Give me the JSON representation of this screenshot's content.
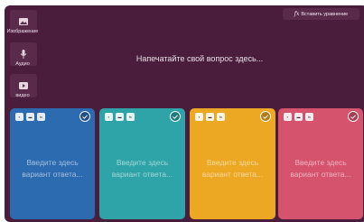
{
  "sidebar": {
    "image_label": "Изображение",
    "audio_label": "Аудио",
    "video_label": "видео"
  },
  "toolbar": {
    "insert_equation_label": "Вставить уравнение"
  },
  "question": {
    "placeholder": "Напечатайте свой вопрос здесь..."
  },
  "answers": [
    {
      "placeholder_line1": "Введите здесь",
      "placeholder_line2": "вариант ответа...",
      "color": "#2d6bb0"
    },
    {
      "placeholder_line1": "Введите здесь",
      "placeholder_line2": "вариант ответа...",
      "color": "#2ea3a8"
    },
    {
      "placeholder_line1": "Введите здесь",
      "placeholder_line2": "вариант ответа...",
      "color": "#eca723"
    },
    {
      "placeholder_line1": "Введите здесь",
      "placeholder_line2": "вариант ответа...",
      "color": "#d6536e"
    }
  ],
  "colors": {
    "background": "#4a1d3c",
    "button": "#5a2a4b"
  }
}
